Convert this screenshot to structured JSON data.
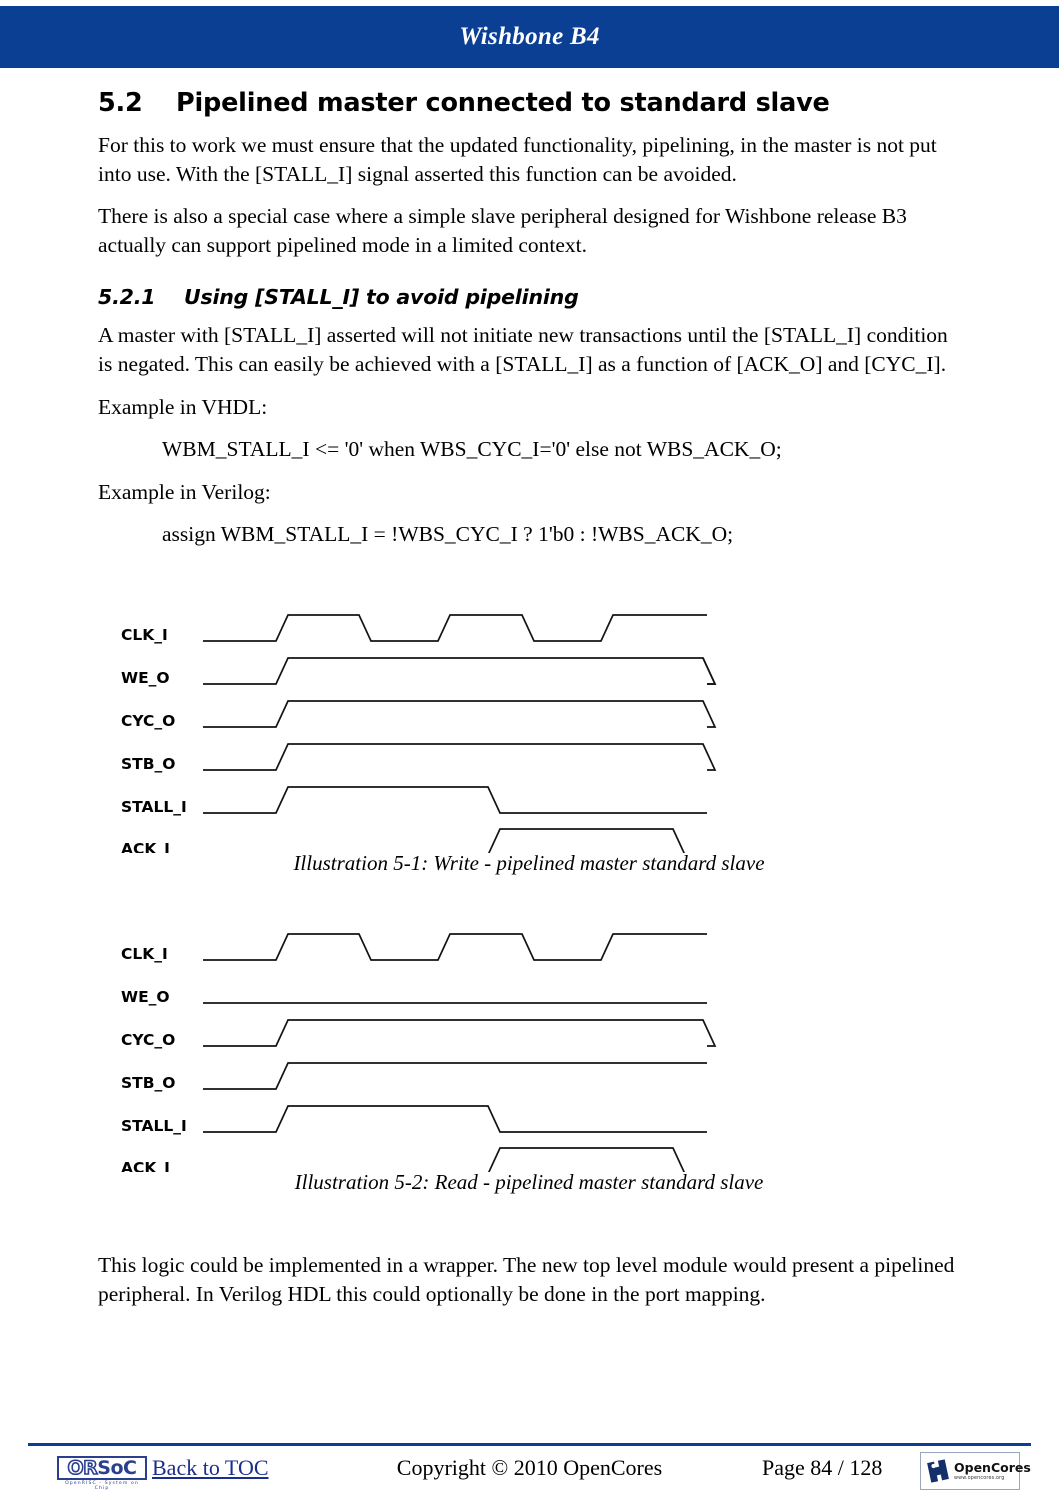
{
  "header": {
    "title": "Wishbone B4"
  },
  "section": {
    "number": "5.2",
    "title": "Pipelined master connected to standard slave",
    "paragraph1": "For this to work we must ensure that the updated functionality, pipelining, in the master is not put into use. With the [STALL_I] signal asserted this function can be avoided.",
    "paragraph2": "There is also a special case where a simple slave peripheral designed for Wishbone release B3 actually can support pipelined mode in a limited context."
  },
  "subsection": {
    "number": "5.2.1",
    "title": "Using [STALL_I] to avoid pipelining",
    "paragraph1": "A master with [STALL_I] asserted will not initiate new transactions until the [STALL_I] condition is negated. This can easily be achieved with a [STALL_I] as a function of [ACK_O] and [CYC_I].",
    "vhdl_label": "Example in VHDL:",
    "vhdl_code": "WBM_STALL_I <= '0' when WBS_CYC_I='0' else not WBS_ACK_O;",
    "verilog_label": "Example in Verilog:",
    "verilog_code": "assign  WBM_STALL_I = !WBS_CYC_I ? 1'b0 : !WBS_ACK_O;"
  },
  "figures": [
    {
      "id": "illustration-5-1",
      "caption": "Illustration 5-1: Write - pipelined master standard slave",
      "signals": [
        "CLK_I",
        "WE_O",
        "CYC_O",
        "STB_O",
        "STALL_I",
        "ACK_I"
      ]
    },
    {
      "id": "illustration-5-2",
      "caption": "Illustration 5-2: Read - pipelined master standard slave",
      "signals": [
        "CLK_I",
        "WE_O",
        "CYC_O",
        "STB_O",
        "STALL_I",
        "ACK_I"
      ]
    }
  ],
  "closing_paragraph": "This logic could be implemented in a wrapper. The new top level module would present a pipelined peripheral. In Verilog HDL this could optionally be done in the port mapping.",
  "footer": {
    "orsoc_logo_text_a": "OR",
    "orsoc_logo_text_b": "SoC",
    "orsoc_logo_sub": "OpenRISC  -  System on Chip",
    "toc_link": "Back to TOC",
    "copyright": "Copyright © 2010 OpenCores",
    "page": "Page 84 / 128",
    "opencores_name": "OpenCores",
    "opencores_url": "www.opencores.org"
  },
  "colors": {
    "header_blue": "#0b3f94",
    "link_blue": "#1a2e8c",
    "logo_blue": "#2b3f8f",
    "waveform_stroke": "#141414"
  }
}
